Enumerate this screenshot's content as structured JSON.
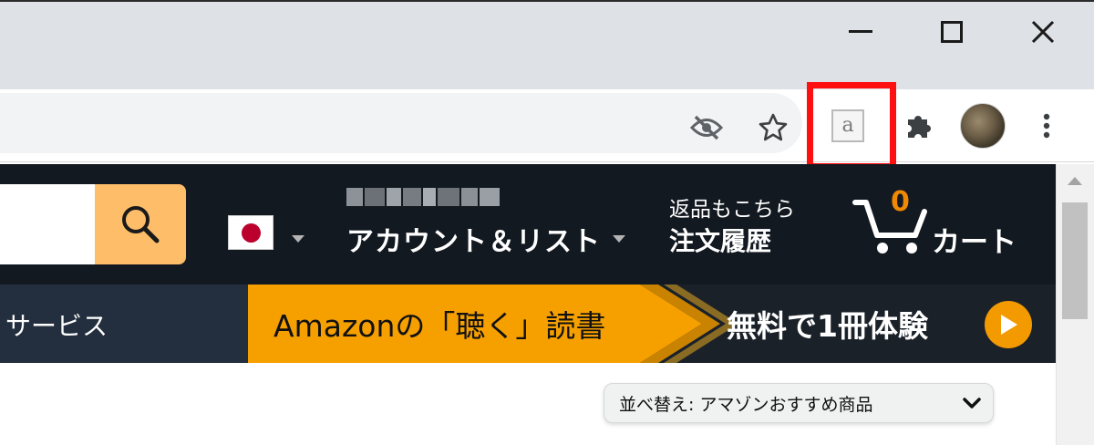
{
  "window": {
    "minimize_icon": "minimize-icon",
    "maximize_icon": "maximize-icon",
    "close_icon": "close-icon"
  },
  "toolbar": {
    "icons": [
      "eye-off-icon",
      "star-icon",
      "amazon-extension-icon",
      "puzzle-icon",
      "profile-avatar",
      "more-vert-icon"
    ],
    "extension_letter": "a",
    "highlight_color": "#ff1010"
  },
  "header": {
    "account_label": "アカウント＆リスト",
    "returns_small": "返品もこちら",
    "returns_big": "注文履歴",
    "cart_count": "0",
    "cart_label": "カート",
    "brand_colors": {
      "dark": "#131921",
      "search_button": "#febd69",
      "cart_count": "#f08804"
    }
  },
  "subnav": {
    "services": "サービス",
    "banner_left": "Amazonの「聴く」読書",
    "banner_right": "無料で1冊体験",
    "banner_colors": {
      "orange": "#f6a000",
      "dark": "#232f3e"
    }
  },
  "sort": {
    "label": "並べ替え: アマゾンおすすめ商品"
  }
}
